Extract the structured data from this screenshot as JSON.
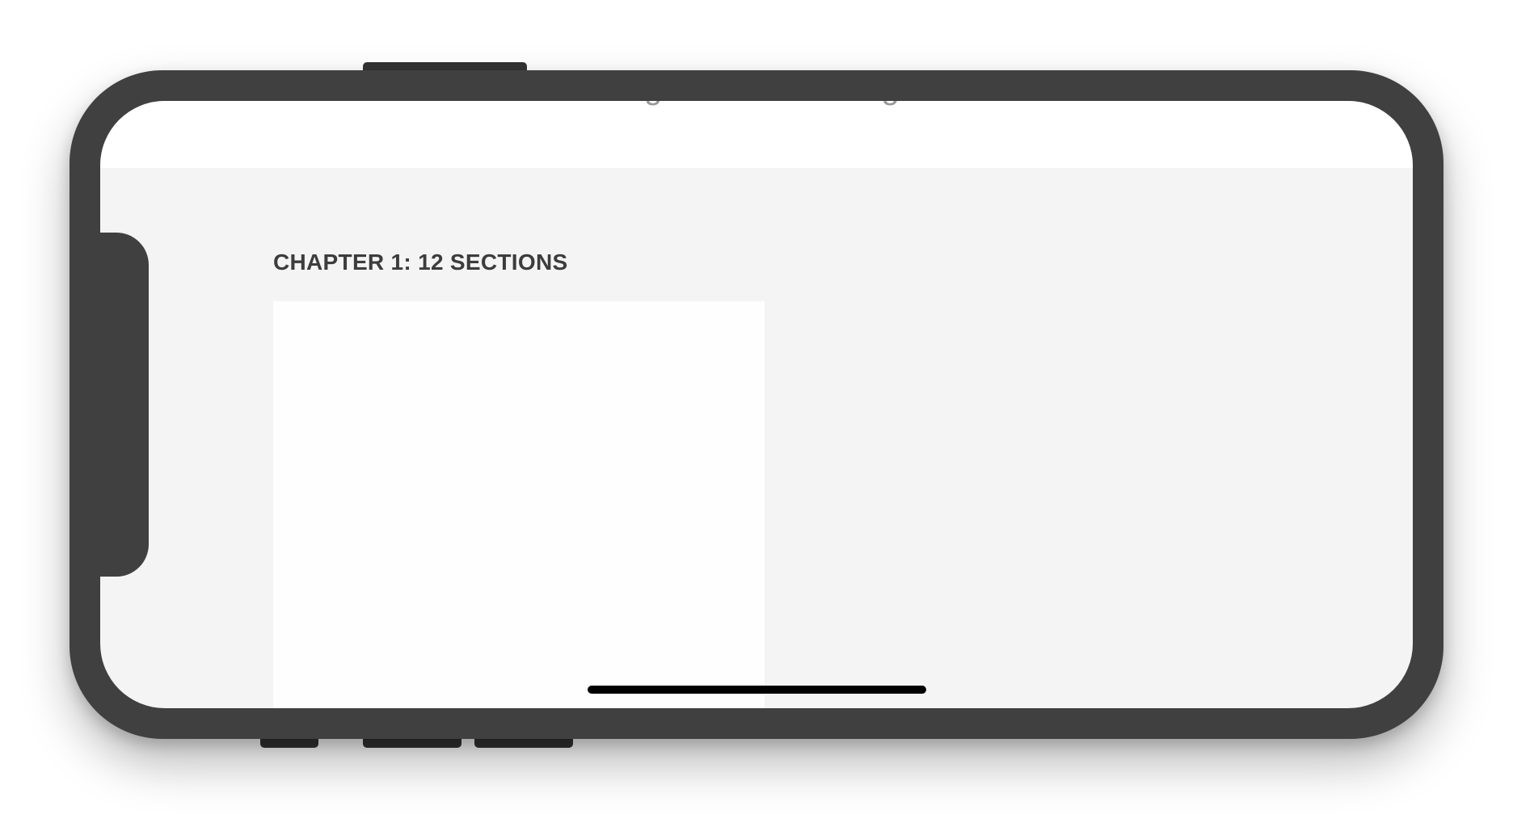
{
  "app": {
    "scrolled_subtitle": "For beginners and designers"
  },
  "content": {
    "chapter_heading": "CHAPTER 1: 12 SECTIONS"
  },
  "colors": {
    "device_frame": "#404040",
    "screen_background": "#f4f4f4",
    "card_background": "#fefefe",
    "heading_text": "#3c3c3c"
  }
}
